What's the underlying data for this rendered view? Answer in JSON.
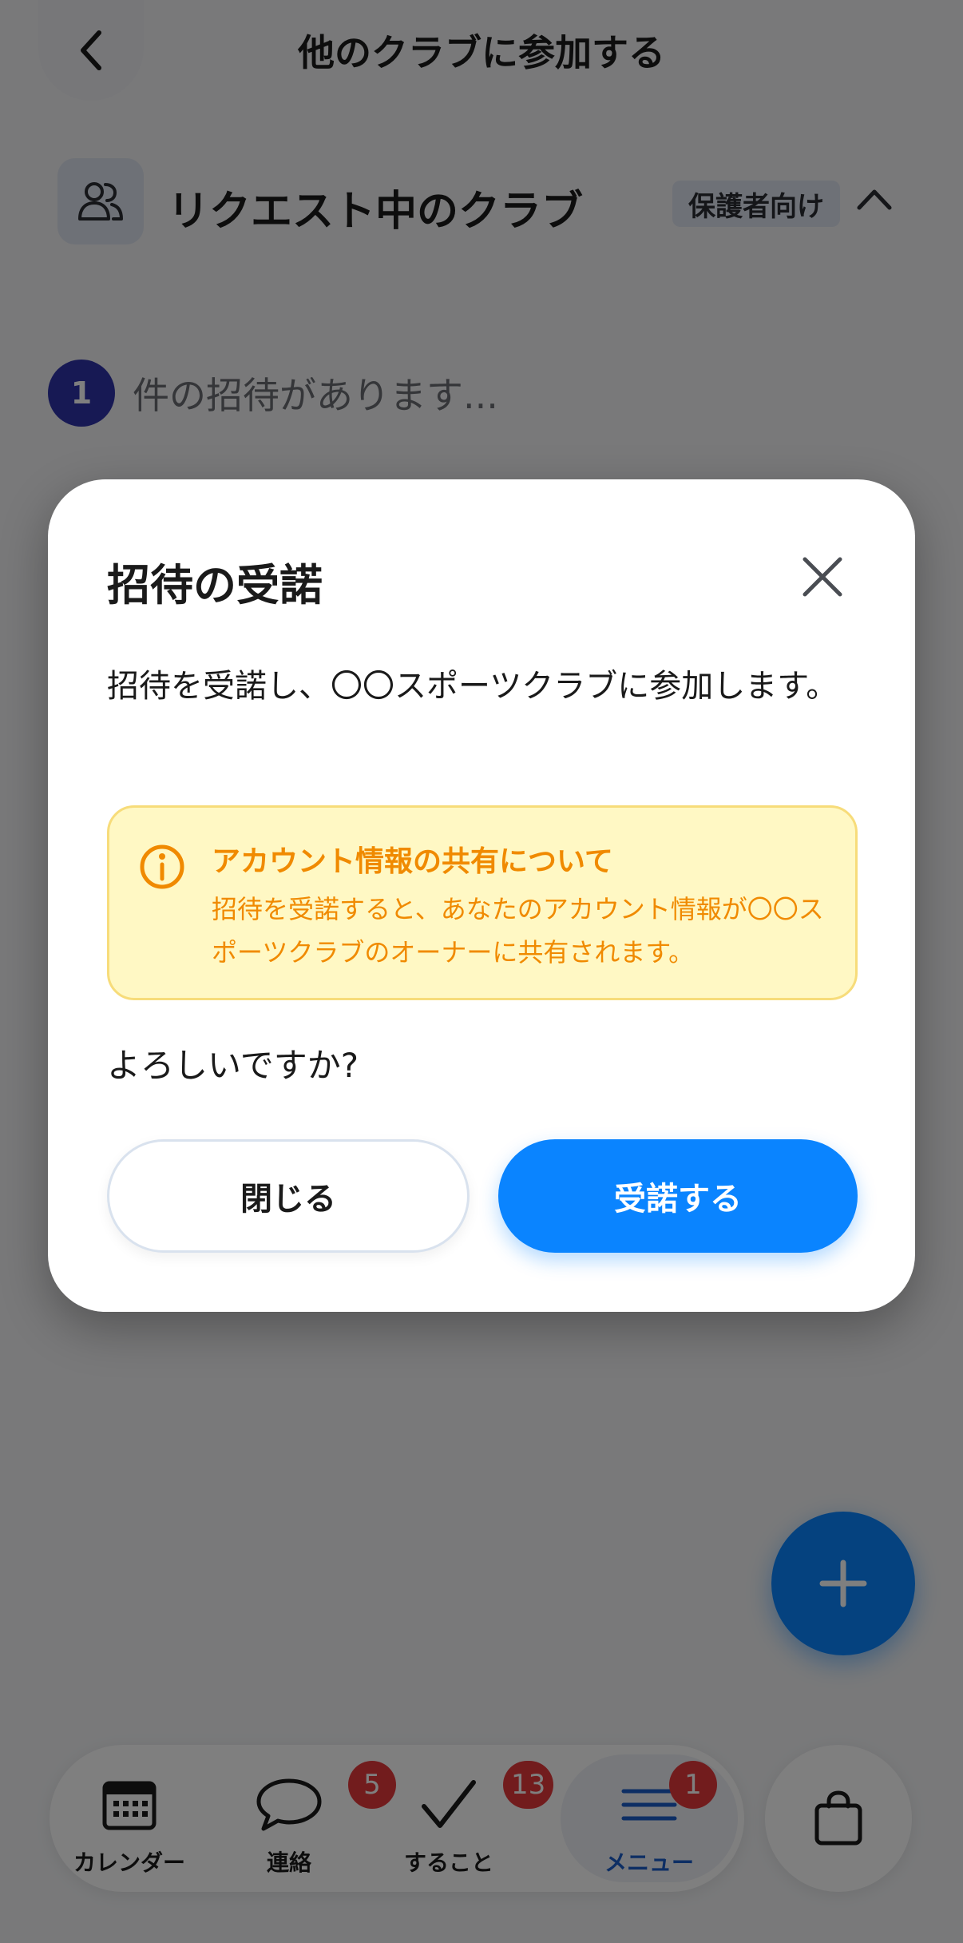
{
  "header": {
    "title": "他のクラブに参加する"
  },
  "section": {
    "title": "リクエスト中のクラブ",
    "badge": "保護者向け",
    "invite_count": "1",
    "invite_text": "件の招待があります..."
  },
  "modal": {
    "title": "招待の受諾",
    "body": "招待を受諾し、〇〇スポーツクラブに参加します。",
    "notice_title": "アカウント情報の共有について",
    "notice_text": "招待を受諾すると、あなたのアカウント情報が〇〇スポーツクラブのオーナーに共有されます。",
    "question": "よろしいですか?",
    "close_label": "閉じる",
    "accept_label": "受諾する"
  },
  "tabbar": {
    "items": [
      {
        "label": "カレンダー",
        "icon": "calendar-icon",
        "badge": null
      },
      {
        "label": "連絡",
        "icon": "chat-bubble-icon",
        "badge": "5"
      },
      {
        "label": "すること",
        "icon": "checkmark-icon",
        "badge": "13"
      },
      {
        "label": "メニュー",
        "icon": "menu-icon",
        "badge": "1"
      }
    ],
    "active_index": 3
  },
  "colors": {
    "accent": "#0a84ff",
    "badge_red": "#e5383b",
    "notice_bg": "#fff8c4",
    "notice_text": "#f08a00",
    "count_badge": "#2f33a8"
  }
}
